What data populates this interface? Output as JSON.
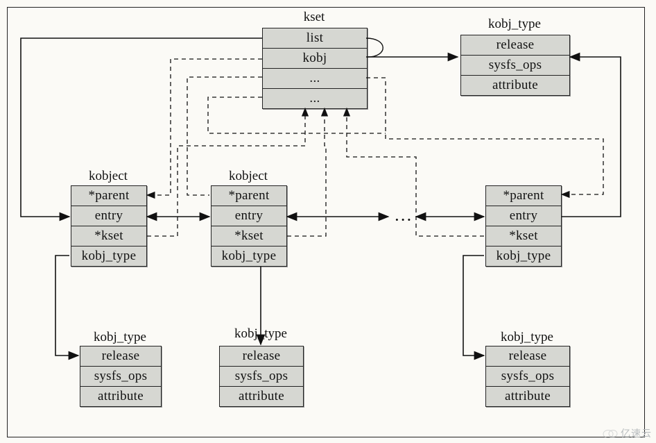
{
  "titles": {
    "kset": "kset",
    "kobj_type_top": "kobj_type",
    "kobject_1": "kobject",
    "kobject_2": "kobject",
    "kobj_type_b1": "kobj_type",
    "kobj_type_b2": "kobj_type",
    "kobj_type_b3": "kobj_type"
  },
  "kset": {
    "r0": "list",
    "r1": "kobj",
    "r2": "...",
    "r3": "..."
  },
  "kobj_type_top": {
    "r0": "release",
    "r1": "sysfs_ops",
    "r2": "attribute"
  },
  "kobject_fields": {
    "r0": "*parent",
    "r1": "entry",
    "r2": "*kset",
    "r3": "kobj_type"
  },
  "kobject_right_fields": {
    "r0": "*parent",
    "r1": "entry",
    "r2": "*kset",
    "r3": "kobj_type"
  },
  "kobj_type_fields": {
    "r0": "release",
    "r1": "sysfs_ops",
    "r2": "attribute"
  },
  "dots_mid": "...",
  "watermark": "亿速云"
}
